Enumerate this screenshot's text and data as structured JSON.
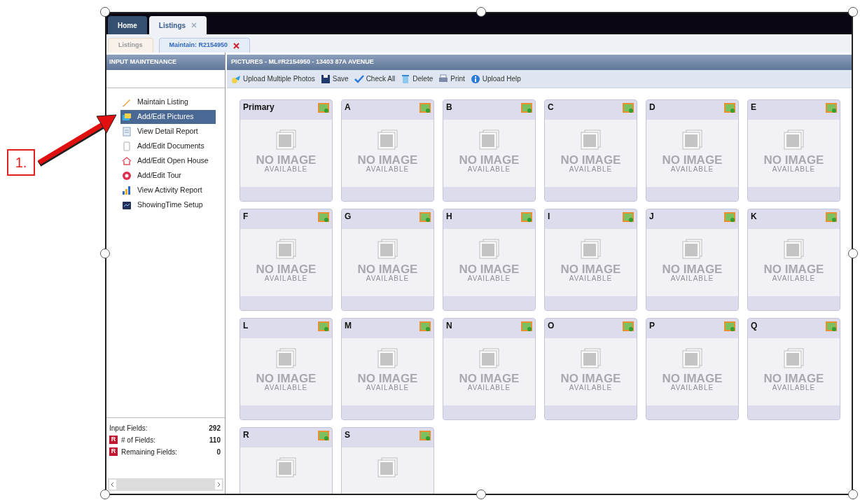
{
  "annotation": {
    "label": "1."
  },
  "top_tabs": [
    {
      "label": "Home",
      "selected": false,
      "closable": false
    },
    {
      "label": "Listings",
      "selected": true,
      "closable": true
    }
  ],
  "sub_tabs": [
    {
      "label": "Listings",
      "selected": false,
      "closable": false
    },
    {
      "label": "Maintain: R2154950",
      "selected": true,
      "closable": true
    }
  ],
  "sidebar": {
    "title": "INPUT MAINTENANCE",
    "items": [
      {
        "label": "Maintain Listing",
        "kind": "pencil",
        "selected": false
      },
      {
        "label": "Add/Edit Pictures",
        "kind": "pictures",
        "selected": true
      },
      {
        "label": "View Detail Report",
        "kind": "report",
        "selected": false
      },
      {
        "label": "Add/Edit Documents",
        "kind": "document",
        "selected": false
      },
      {
        "label": "Add/Edit Open House",
        "kind": "house",
        "selected": false
      },
      {
        "label": "Add/Edit Tour",
        "kind": "tour",
        "selected": false
      },
      {
        "label": "View Activity Report",
        "kind": "chart",
        "selected": false
      },
      {
        "label": "ShowingTime Setup",
        "kind": "setup",
        "selected": false
      }
    ],
    "stats": [
      {
        "label": "Input Fields:",
        "value": "292"
      },
      {
        "label": "# of Fields:",
        "value": "110",
        "badge": "R"
      },
      {
        "label": "Remaining Fields:",
        "value": "0",
        "badge": "R"
      }
    ]
  },
  "panel": {
    "title": "PICTURES - ML#R2154950 - 13403 87A AVENUE",
    "toolbar": [
      {
        "label": "Upload Multiple Photos",
        "kind": "upload"
      },
      {
        "label": "Save",
        "kind": "save"
      },
      {
        "label": "Check All",
        "kind": "check"
      },
      {
        "label": "Delete",
        "kind": "delete"
      },
      {
        "label": "Print",
        "kind": "print"
      },
      {
        "label": "Upload Help",
        "kind": "help"
      }
    ],
    "cards": [
      {
        "label": "Primary",
        "caption": "NO IMAGE",
        "subcaption": "AVAILABLE"
      },
      {
        "label": "A",
        "caption": "NO IMAGE",
        "subcaption": "AVAILABLE"
      },
      {
        "label": "B",
        "caption": "NO IMAGE",
        "subcaption": "AVAILABLE"
      },
      {
        "label": "C",
        "caption": "NO IMAGE",
        "subcaption": "AVAILABLE"
      },
      {
        "label": "D",
        "caption": "NO IMAGE",
        "subcaption": "AVAILABLE"
      },
      {
        "label": "E",
        "caption": "NO IMAGE",
        "subcaption": "AVAILABLE"
      },
      {
        "label": "F",
        "caption": "NO IMAGE",
        "subcaption": "AVAILABLE"
      },
      {
        "label": "G",
        "caption": "NO IMAGE",
        "subcaption": "AVAILABLE"
      },
      {
        "label": "H",
        "caption": "NO IMAGE",
        "subcaption": "AVAILABLE"
      },
      {
        "label": "I",
        "caption": "NO IMAGE",
        "subcaption": "AVAILABLE"
      },
      {
        "label": "J",
        "caption": "NO IMAGE",
        "subcaption": "AVAILABLE"
      },
      {
        "label": "K",
        "caption": "NO IMAGE",
        "subcaption": "AVAILABLE"
      },
      {
        "label": "L",
        "caption": "NO IMAGE",
        "subcaption": "AVAILABLE"
      },
      {
        "label": "M",
        "caption": "NO IMAGE",
        "subcaption": "AVAILABLE"
      },
      {
        "label": "N",
        "caption": "NO IMAGE",
        "subcaption": "AVAILABLE"
      },
      {
        "label": "O",
        "caption": "NO IMAGE",
        "subcaption": "AVAILABLE"
      },
      {
        "label": "P",
        "caption": "NO IMAGE",
        "subcaption": "AVAILABLE"
      },
      {
        "label": "Q",
        "caption": "NO IMAGE",
        "subcaption": "AVAILABLE"
      },
      {
        "label": "R"
      },
      {
        "label": "S"
      }
    ]
  }
}
